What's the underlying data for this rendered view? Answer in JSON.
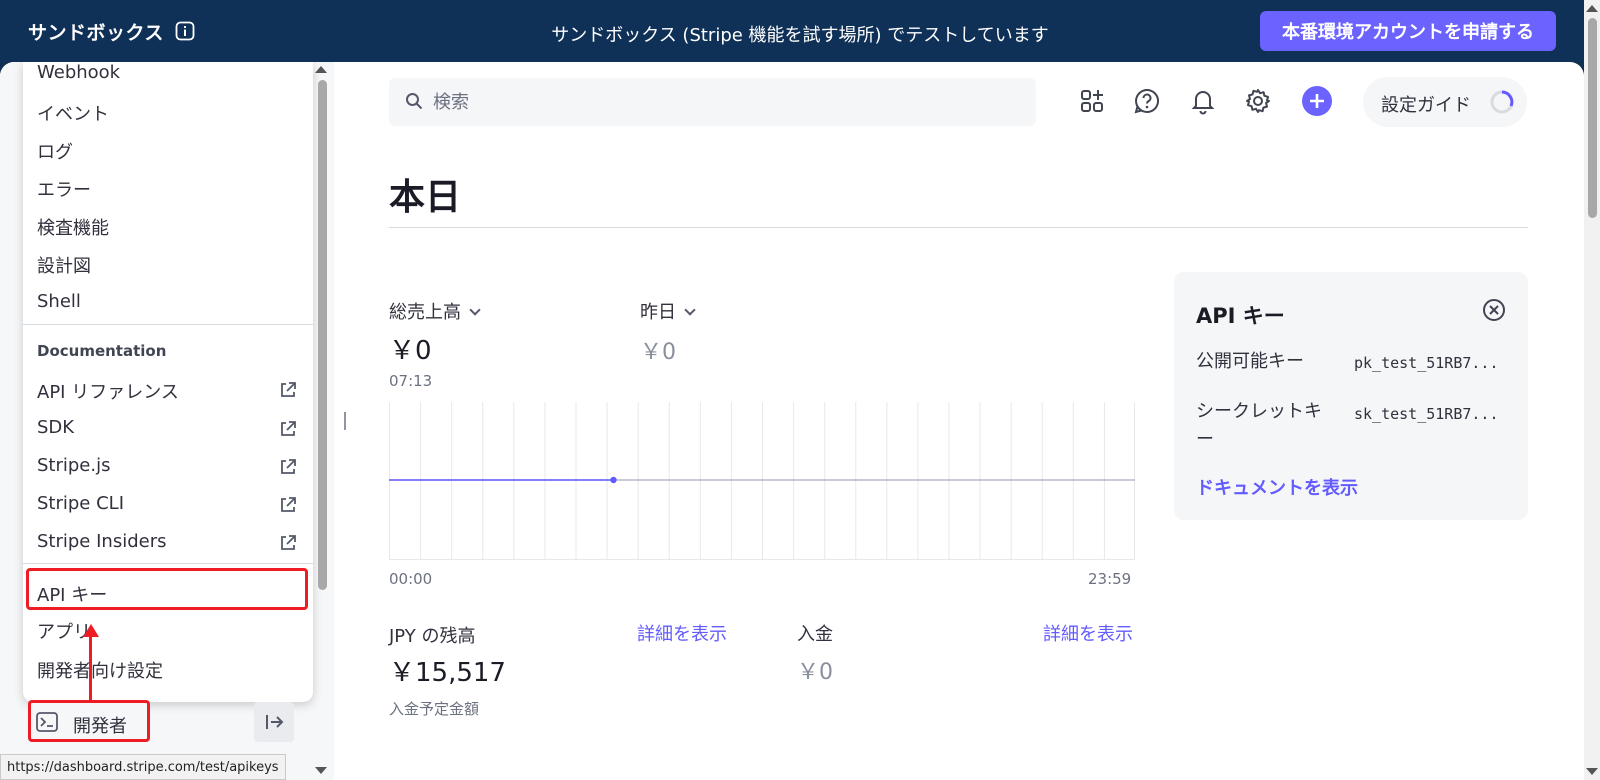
{
  "banner": {
    "brand": "サンドボックス",
    "center_text": "サンドボックス (Stripe 機能を試す場所) でテストしています",
    "apply_button": "本番環境アカウントを申請する"
  },
  "menu": {
    "items_top": [
      "Webhook",
      "イベント",
      "ログ",
      "エラー",
      "検査機能",
      "設計図",
      "Shell"
    ],
    "section_title": "Documentation",
    "doc_items": [
      "API リファレンス",
      "SDK",
      "Stripe.js",
      "Stripe CLI",
      "Stripe Insiders"
    ],
    "items_bottom": [
      "API キー",
      "アプリ",
      "開発者向け設定"
    ]
  },
  "sidebar": {
    "developer_label": "開発者",
    "status_url": "https://dashboard.stripe.com/test/apikeys"
  },
  "header": {
    "search_placeholder": "検索",
    "setup_guide": "設定ガイド"
  },
  "main": {
    "title": "本日",
    "gross_label": "総売上高",
    "gross_value": "￥0",
    "gross_time": "07:13",
    "yesterday_label": "昨日",
    "yesterday_value": "￥0",
    "axis_start": "00:00",
    "axis_end": "23:59",
    "jpy_balance_label": "JPY の残高",
    "jpy_balance_value": "￥15,517",
    "jpy_balance_sub": "入金予定金額",
    "deposit_label": "入金",
    "deposit_value": "￥0",
    "view_details": "詳細を表示"
  },
  "api_card": {
    "title": "API キー",
    "publishable_label": "公開可能キー",
    "publishable_value": "pk_test_51RB7...",
    "secret_label": "シークレットキー",
    "secret_value": "sk_test_51RB7...",
    "docs_link": "ドキュメントを表示"
  },
  "colors": {
    "banner_bg": "#0f3057",
    "accent": "#635bff",
    "annotation_red": "#ee1c25"
  },
  "chart_data": {
    "type": "line",
    "x": [
      "00:00",
      "07:13"
    ],
    "values": [
      0,
      0
    ],
    "xlabel": "",
    "ylabel": "",
    "x_ticks": [
      "00:00",
      "23:59"
    ],
    "grid": true
  }
}
